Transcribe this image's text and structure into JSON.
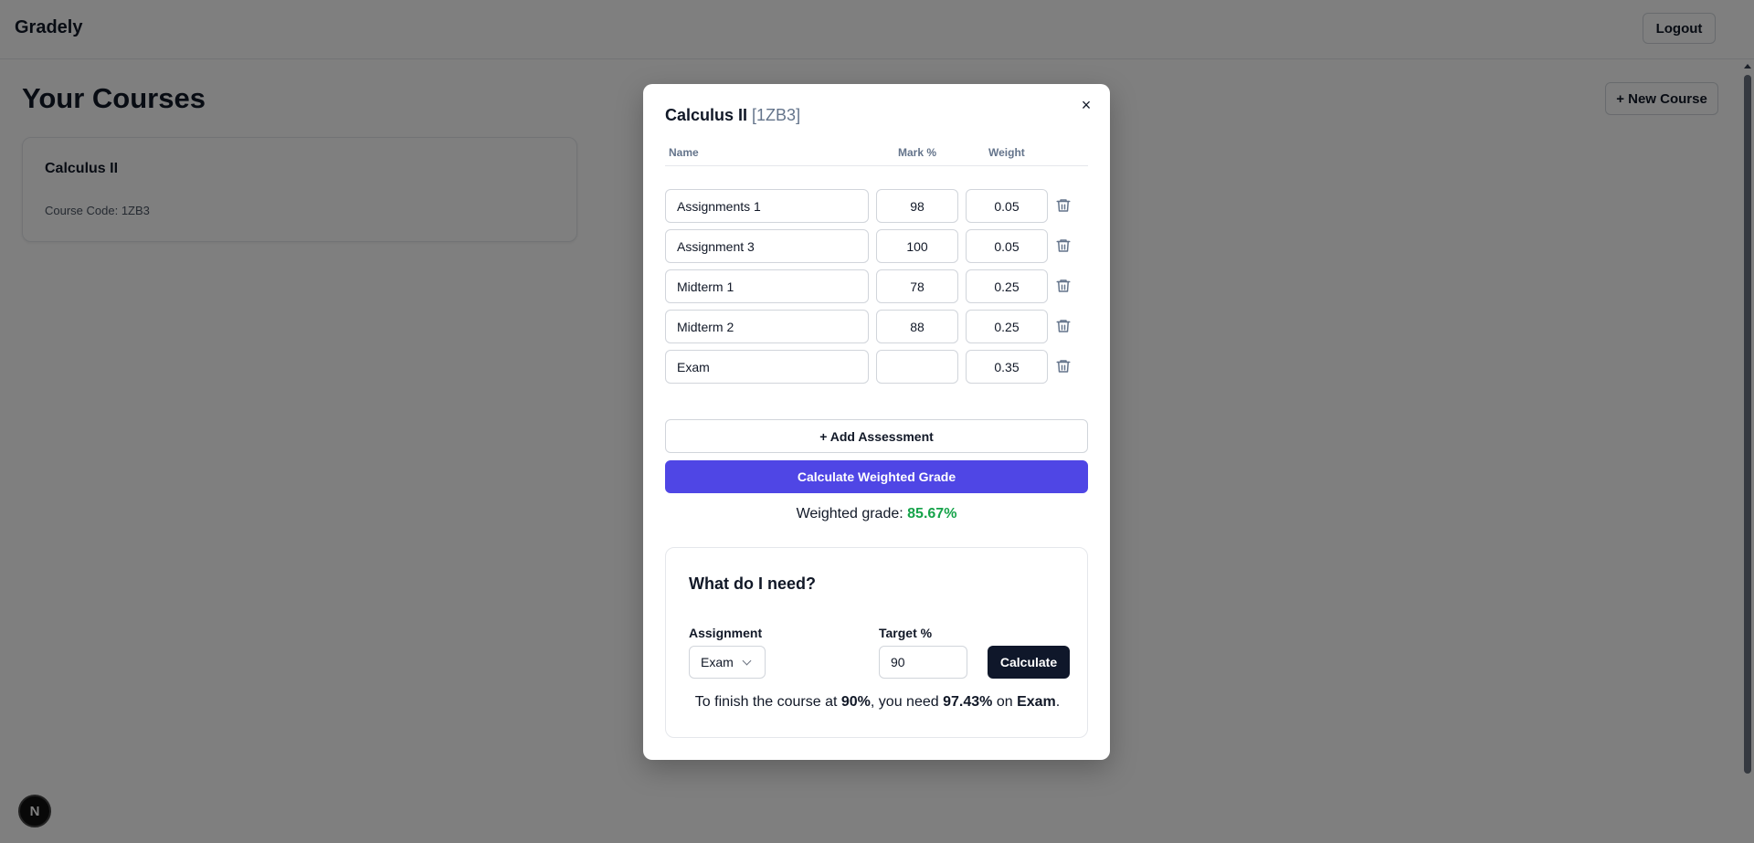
{
  "app": {
    "brand": "Gradely",
    "logout_label": "Logout"
  },
  "page": {
    "title": "Your Courses",
    "new_course_label": "+ New Course"
  },
  "course_card": {
    "name": "Calculus II",
    "code_text": "Course Code: 1ZB3"
  },
  "badge": {
    "letter": "N"
  },
  "modal": {
    "title": "Calculus II",
    "code": "[1ZB3]",
    "close_glyph": "×",
    "columns": {
      "name": "Name",
      "mark": "Mark %",
      "weight": "Weight"
    },
    "assessments": [
      {
        "name": "Assignments 1",
        "mark": "98",
        "weight": "0.05"
      },
      {
        "name": "Assignment 3",
        "mark": "100",
        "weight": "0.05"
      },
      {
        "name": "Midterm 1",
        "mark": "78",
        "weight": "0.25"
      },
      {
        "name": "Midterm 2",
        "mark": "88",
        "weight": "0.25"
      },
      {
        "name": "Exam",
        "mark": "",
        "weight": "0.35"
      }
    ],
    "add_label": "+ Add Assessment",
    "calc_label": "Calculate Weighted Grade",
    "weighted_prefix": "Weighted grade:",
    "weighted_value": "85.67%",
    "need": {
      "title": "What do I need?",
      "assignment_label": "Assignment",
      "assignment_value": "Exam",
      "target_label": "Target %",
      "target_value": "90",
      "calc_label": "Calculate",
      "result_prefix": "To finish the course at",
      "result_target": "90%",
      "result_mid": ", you need",
      "result_needed": "97.43%",
      "result_on": "on",
      "result_assignment": "Exam",
      "result_end": "."
    }
  },
  "colors": {
    "primary": "#4f46e5",
    "dark_button": "#0f172a",
    "success": "#16a34a",
    "muted": "#64748b"
  }
}
